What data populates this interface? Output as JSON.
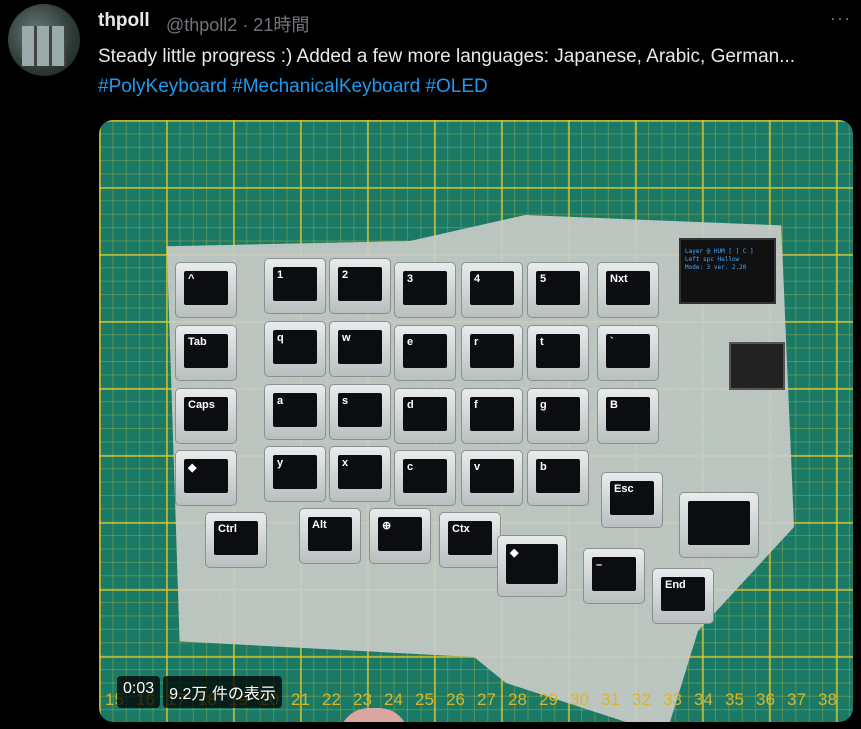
{
  "tweet": {
    "name": "thpoll",
    "handle": "@thpoll2 · 21時間",
    "more": "···",
    "text": "Steady little progress :) Added a few more languages: Japanese, Arabic, German... ",
    "hashtags": [
      "#PolyKeyboard",
      "#MechanicalKeyboard",
      "#OLED"
    ]
  },
  "video": {
    "time": "0:03",
    "views": "9.2万 件の表示",
    "ruler": [
      "15",
      "16",
      "17",
      "18",
      "19",
      "20",
      "21",
      "22",
      "23",
      "24",
      "25",
      "26",
      "27",
      "28",
      "29",
      "30",
      "31",
      "32",
      "33",
      "34",
      "35",
      "36",
      "37",
      "38"
    ],
    "oled_lines": [
      "Layer @ HUM [ ] C ]",
      "Left spc Hellow",
      "Mode: 3 ver. 2.20"
    ],
    "keys": [
      [
        "^",
        "1",
        "2",
        "3",
        "4",
        "5",
        "Nxt"
      ],
      [
        "Tab",
        "q",
        "w",
        "e",
        "r",
        "t",
        "`"
      ],
      [
        "Caps",
        "a",
        "s",
        "d",
        "f",
        "g",
        "B"
      ],
      [
        "◆",
        "y",
        "x",
        "c",
        "v",
        "b"
      ],
      [
        "Ctrl",
        "Alt",
        "⊕",
        "Ctx"
      ]
    ],
    "thumb_keys": [
      "Esc",
      "",
      "◆",
      "–",
      "End"
    ]
  }
}
